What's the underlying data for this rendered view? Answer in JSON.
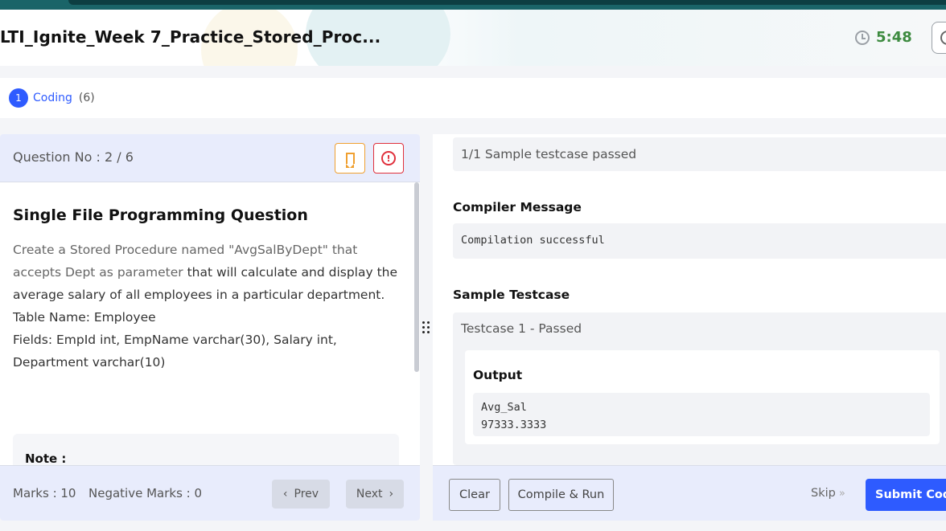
{
  "header": {
    "title": "LTI_Ignite_Week 7_Practice_Stored_Proc...",
    "timer": "5:48",
    "icons": {
      "timer": "clock-icon",
      "action": "circle-icon"
    }
  },
  "section": {
    "number": "1",
    "label": "Coding",
    "count": "(6)"
  },
  "question": {
    "number_label": "Question No : 2 / 6",
    "title": "Single File Programming Question",
    "text_line1": "Create a Stored Procedure named \"AvgSalByDept\" that accepts Dept as parameter",
    "text_highlight": "that will calculate and display the average salary of all employees in a particular department.",
    "table_name": "Table Name: Employee",
    "fields": "Fields: EmpId int, EmpName varchar(30), Salary int, Department varchar(10)",
    "note_label": "Note :",
    "marks": "Marks : 10",
    "negative_marks": "Negative Marks : 0",
    "prev_label": "Prev",
    "next_label": "Next",
    "icons": {
      "bookmark": "bookmark-icon",
      "report": "alert-circle-icon"
    }
  },
  "results": {
    "sample_status": "1/1 Sample testcase passed",
    "compiler_heading": "Compiler Message",
    "compiler_message": "Compilation successful",
    "testcase_heading": "Sample Testcase",
    "testcase_label": "Testcase 1 - Passed",
    "output_heading": "Output",
    "output_line1": "Avg_Sal",
    "output_line2": "97333.3333"
  },
  "footer": {
    "clear_label": "Clear",
    "compile_label": "Compile & Run",
    "skip_label": "Skip",
    "submit_label": "Submit Code"
  },
  "colors": {
    "accent": "#2e5bff",
    "timer": "#3d8b40",
    "bookmark": "#f0a030",
    "report": "#e0303c"
  }
}
